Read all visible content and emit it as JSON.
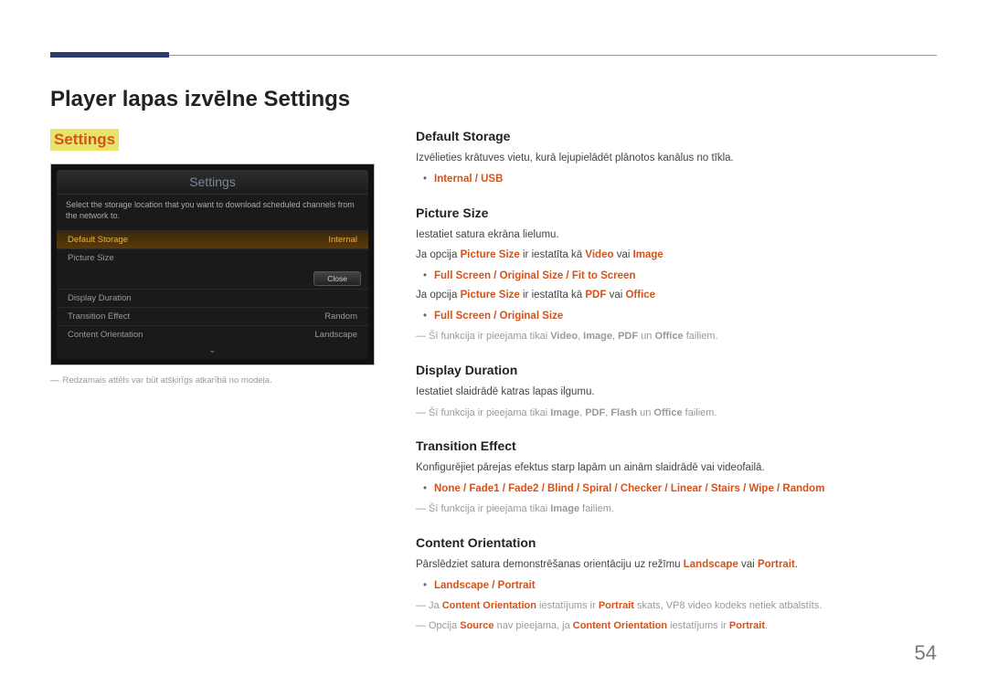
{
  "page": {
    "title": "Player lapas izvēlne Settings",
    "section_label": "Settings",
    "page_number": "54"
  },
  "screenshot": {
    "title": "Settings",
    "description": "Select the storage location that you want to download scheduled channels from the network to.",
    "rows": [
      {
        "label": "Default Storage",
        "value": "Internal"
      },
      {
        "label": "Picture Size",
        "value": ""
      },
      {
        "label": "Display Duration",
        "value": ""
      },
      {
        "label": "Transition Effect",
        "value": "Random"
      },
      {
        "label": "Content Orientation",
        "value": "Landscape"
      }
    ],
    "close_label": "Close"
  },
  "caption": "Redzamais attēls var būt atšķirīgs atkarībā no modeļa.",
  "sections": {
    "default_storage": {
      "heading": "Default Storage",
      "intro": "Izvēlieties krātuves vietu, kurā lejupielādēt plānotos kanālus no tīkla.",
      "options": "Internal / USB"
    },
    "picture_size": {
      "heading": "Picture Size",
      "intro": "Iestatiet satura ekrāna lielumu.",
      "line1_prefix": "Ja opcija ",
      "line1_opt": "Picture Size",
      "line1_mid": " ir iestatīta kā ",
      "line1_v1": "Video",
      "line1_or": " vai ",
      "line1_v2": "Image",
      "options1": "Full Screen / Original Size / Fit to Screen",
      "line2_prefix": "Ja opcija ",
      "line2_opt": "Picture Size",
      "line2_mid": " ir iestatīta kā ",
      "line2_v1": "PDF",
      "line2_or": " vai ",
      "line2_v2": "Office",
      "options2": "Full Screen / Original Size",
      "note_prefix": "Šī funkcija ir pieejama tikai ",
      "note_v": "Video",
      "note_i": "Image",
      "note_p": "PDF",
      "note_un": " un ",
      "note_o": "Office",
      "note_suffix": " failiem."
    },
    "display_duration": {
      "heading": "Display Duration",
      "intro": "Iestatiet slaidrādē katras lapas ilgumu.",
      "note_prefix": "Šī funkcija ir pieejama tikai ",
      "note_i": "Image",
      "note_p": "PDF",
      "note_f": "Flash",
      "note_un": " un ",
      "note_o": "Office",
      "note_suffix": " failiem."
    },
    "transition_effect": {
      "heading": "Transition Effect",
      "intro": "Konfigurējiet pārejas efektus starp lapām un ainām slaidrādē vai videofailā.",
      "options": "None / Fade1 / Fade2 / Blind / Spiral / Checker / Linear / Stairs / Wipe / Random",
      "note_prefix": "Šī funkcija ir pieejama tikai ",
      "note_i": "Image",
      "note_suffix": " failiem."
    },
    "content_orientation": {
      "heading": "Content Orientation",
      "intro_prefix": "Pārslēdziet satura demonstrēšanas orientāciju uz režīmu ",
      "intro_l": "Landscape",
      "intro_or": " vai ",
      "intro_p": "Portrait",
      "options": "Landscape / Portrait",
      "note1_prefix": "Ja ",
      "note1_co": "Content Orientation",
      "note1_mid": " iestatījums ir ",
      "note1_p": "Portrait",
      "note1_suffix": " skats, VP8 video kodeks netiek atbalstīts.",
      "note2_prefix": "Opcija ",
      "note2_s": "Source",
      "note2_mid": " nav pieejama, ja ",
      "note2_co": "Content Orientation",
      "note2_mid2": " iestatījums ir ",
      "note2_p": "Portrait",
      "note2_suffix": "."
    }
  }
}
